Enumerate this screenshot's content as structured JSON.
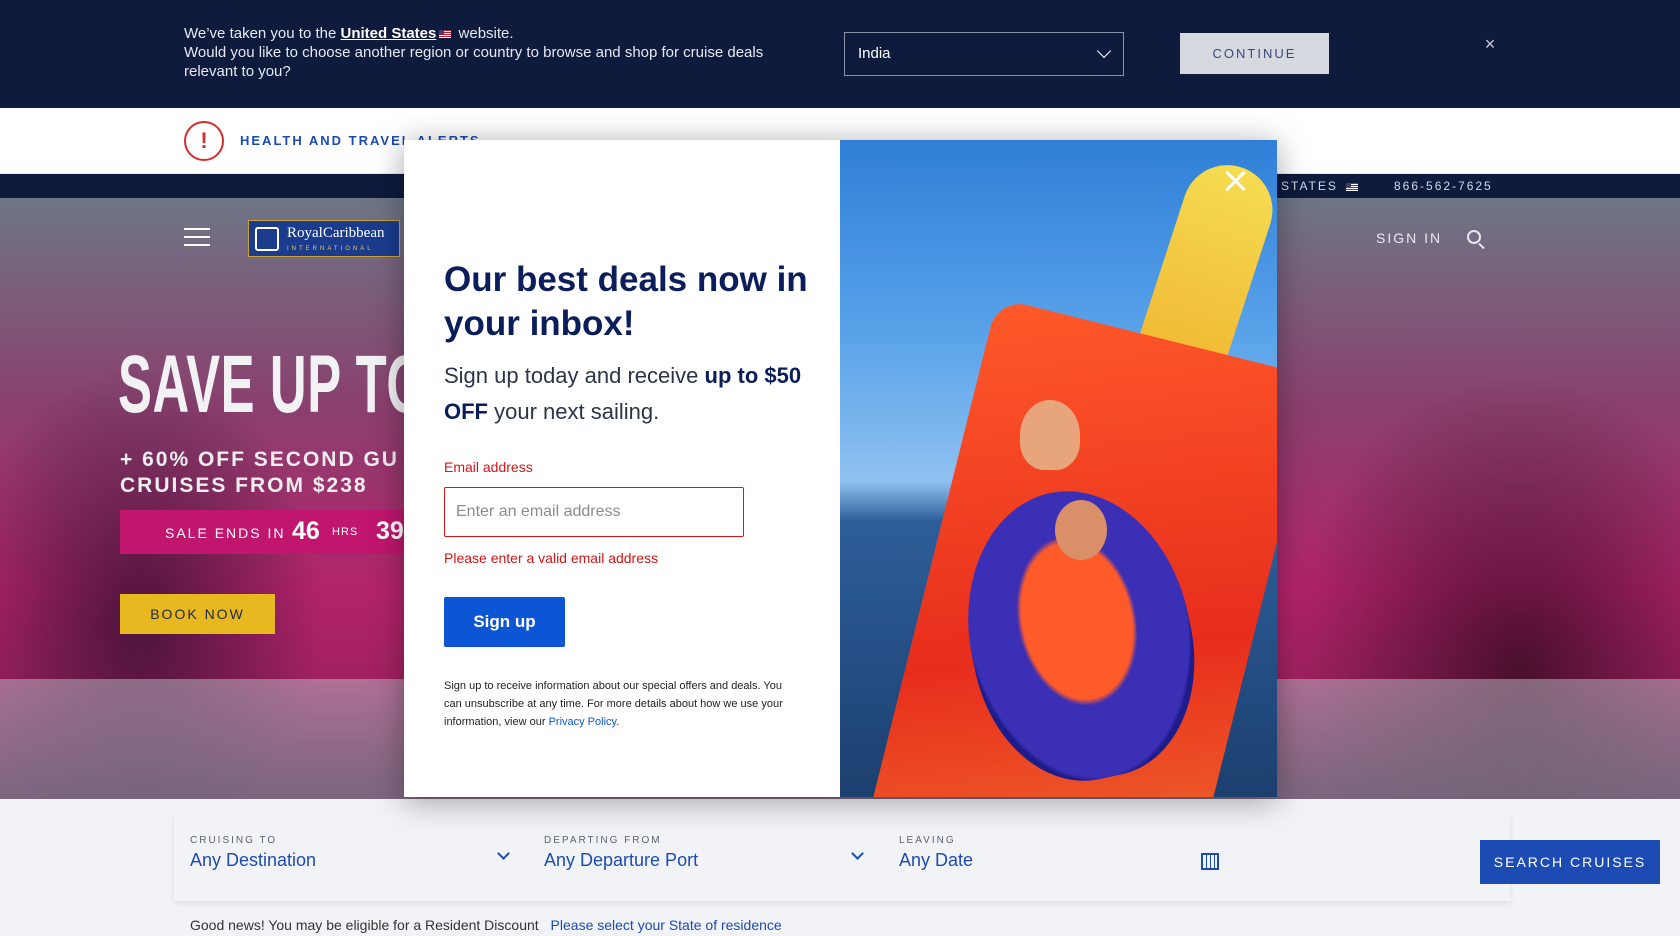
{
  "region_banner": {
    "line1_prefix": "We’ve taken you to the",
    "country_link": "United States",
    "line1_suffix": "website.",
    "line2": "Would you like to choose another region or country to browse and shop for cruise deals relevant to you?",
    "selected_region": "India",
    "continue_label": "CONTINUE",
    "close_label": "×"
  },
  "health": {
    "icon_glyph": "!",
    "label": "HEALTH AND TRAVEL ALERTS"
  },
  "utility": {
    "country": "ED STATES",
    "phone": "866-562-7625"
  },
  "header": {
    "logo_name": "RoyalCaribbean",
    "logo_sub": "INTERNATIONAL",
    "sign_in": "SIGN IN"
  },
  "hero": {
    "headline": "SAVE UP TO",
    "sub1": "+ 60% OFF SECOND GU",
    "sub2": "CRUISES FROM $238",
    "countdown_label": "SALE ENDS IN",
    "countdown_hours": "46",
    "countdown_hours_label": "HRS",
    "countdown_minutes": "39",
    "book_now": "BOOK NOW"
  },
  "search": {
    "cruising_to_label": "CRUISING TO",
    "cruising_to_value": "Any Destination",
    "departing_from_label": "DEPARTING FROM",
    "departing_from_value": "Any Departure Port",
    "leaving_label": "LEAVING",
    "leaving_value": "Any Date",
    "search_button": "SEARCH CRUISES",
    "resident_text": "Good news! You may be eligible for a Resident Discount",
    "resident_link": "Please select your State of residence"
  },
  "modal": {
    "title": "Our best deals now in your inbox!",
    "subtitle_plain": "Sign up today and receive",
    "subtitle_bold1": "up to",
    "subtitle_bold2": "$50 OFF",
    "subtitle_end": "your next sailing.",
    "email_label": "Email address",
    "email_placeholder": "Enter an email address",
    "email_value": "",
    "email_error": "Please enter a valid email address",
    "signup_button": "Sign up",
    "disclaimer": "Sign up to receive information about our special offers and deals. You can unsubscribe at any time. For more details about how we use your information, view our",
    "privacy_link": "Privacy Policy",
    "disclaimer_end": "."
  },
  "colors": {
    "navy": "#0e1b3d",
    "brand_blue": "#1c4bb4",
    "error_red": "#d31515",
    "signup_blue": "#0c56d6",
    "book_now_yellow": "#e7b81f",
    "countdown_magenta": "#c0166e"
  }
}
